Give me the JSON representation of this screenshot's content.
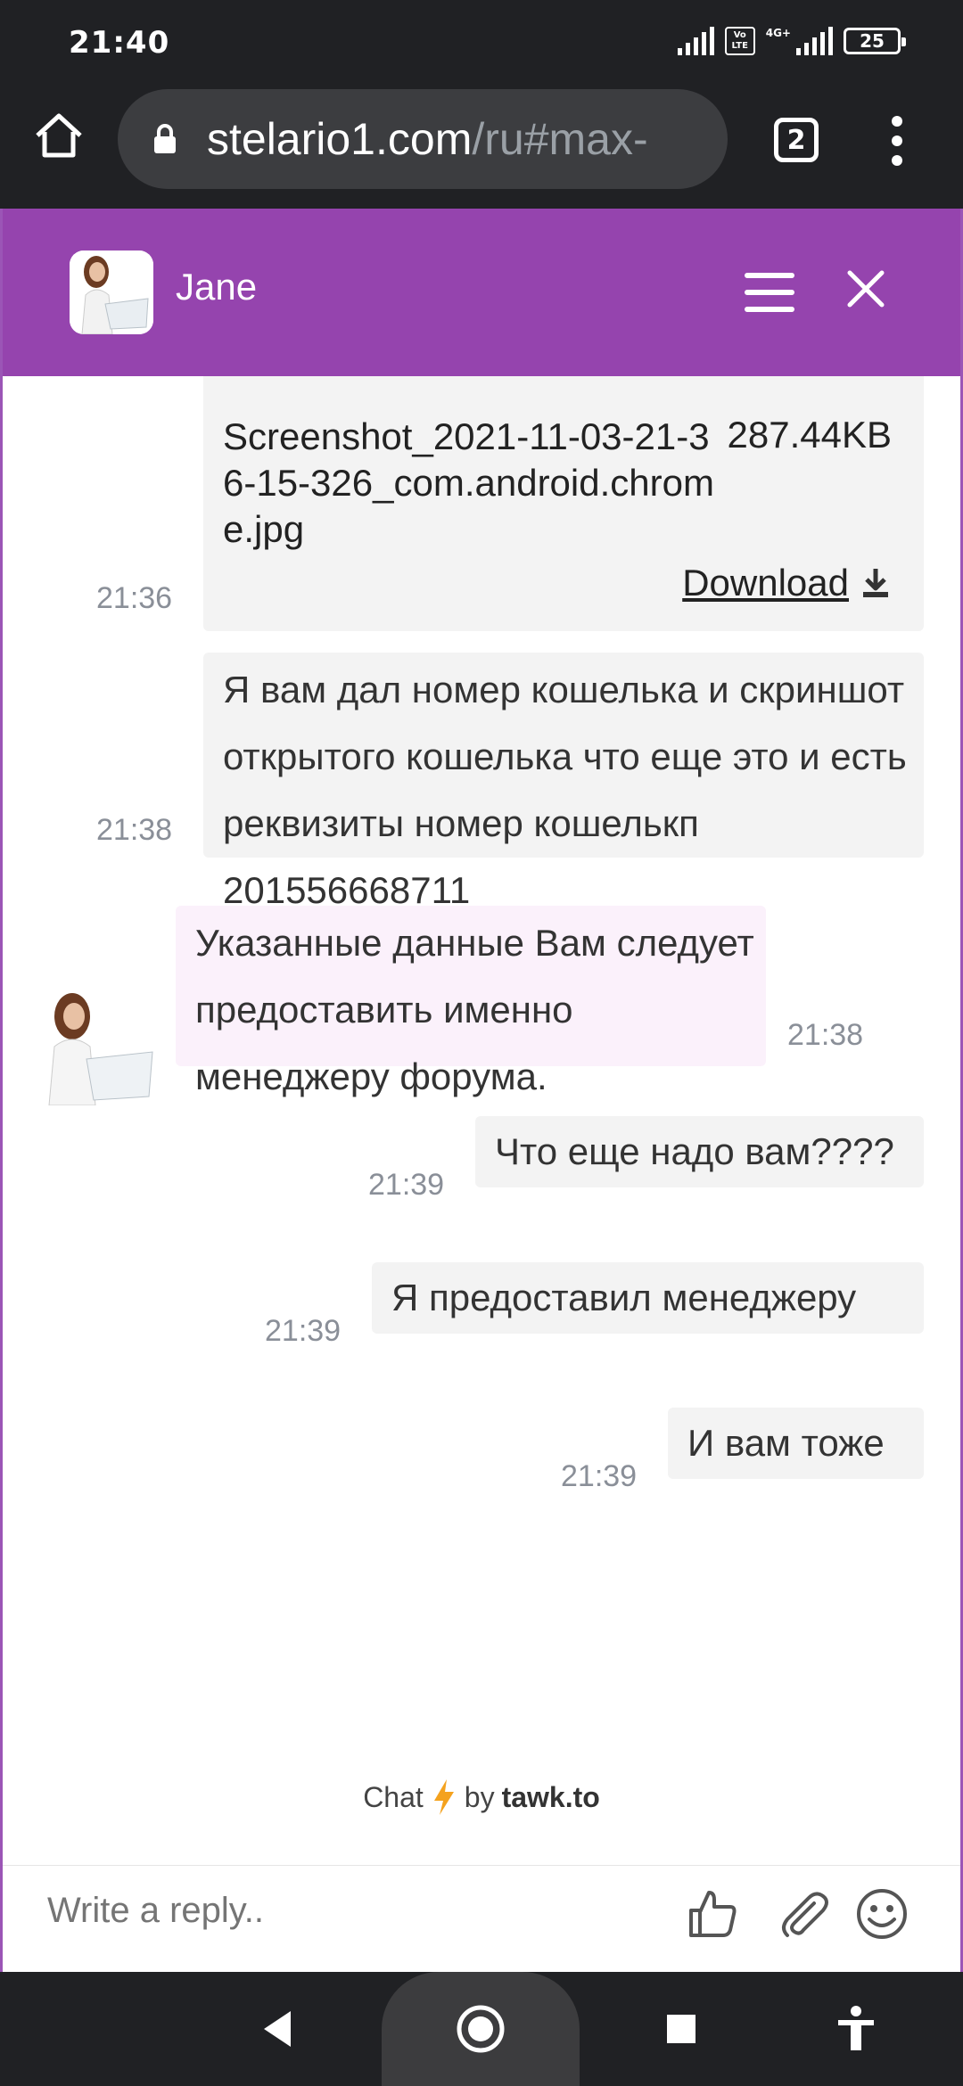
{
  "status_bar": {
    "time": "21:40",
    "network_label": "4G+",
    "volte_label": "Vo LTE",
    "battery": "25"
  },
  "browser": {
    "url_host": "stelario1.com",
    "url_path": "/ru#max-",
    "tab_count": "2"
  },
  "chat": {
    "agent_name": "Jane",
    "messages": [
      {
        "type": "file",
        "file_name": "Screenshot_2021-11-03-21-36-15-326_com.android.chrome.jpg",
        "file_size": "287.44KB",
        "download_label": "Download",
        "time": "21:36"
      },
      {
        "type": "visitor",
        "text": "Я вам дал номер кошелька и скриншот открытого кошелька что еще это и есть реквизиты номер кошелькп 201556668711",
        "time": "21:38"
      },
      {
        "type": "agent",
        "text": "Указанные данные Вам следует предоставить именно менеджеру форума.",
        "time": "21:38"
      },
      {
        "type": "visitor",
        "text": "Что еще надо вам????",
        "time": "21:39"
      },
      {
        "type": "visitor",
        "text": "Я предоставил менеджеру",
        "time": "21:39"
      },
      {
        "type": "visitor",
        "text": "И вам тоже",
        "time": "21:39"
      }
    ],
    "branding_chat": "Chat",
    "branding_by": "by",
    "branding_brand": "tawk.to",
    "reply_placeholder": "Write a reply.."
  },
  "icons": [
    "home-icon",
    "lock-icon",
    "tabs-icon",
    "more-icon",
    "menu-icon",
    "close-icon",
    "download-icon",
    "lightning-icon",
    "thumbs-up-icon",
    "attachment-icon",
    "emoji-icon",
    "back-icon",
    "home-circle-icon",
    "recents-icon",
    "accessibility-icon"
  ],
  "colors": {
    "header": "#9544ae",
    "browser_chrome": "#202124",
    "visitor_bubble": "#f3f3f3",
    "agent_bubble": "#fbf1fb"
  }
}
